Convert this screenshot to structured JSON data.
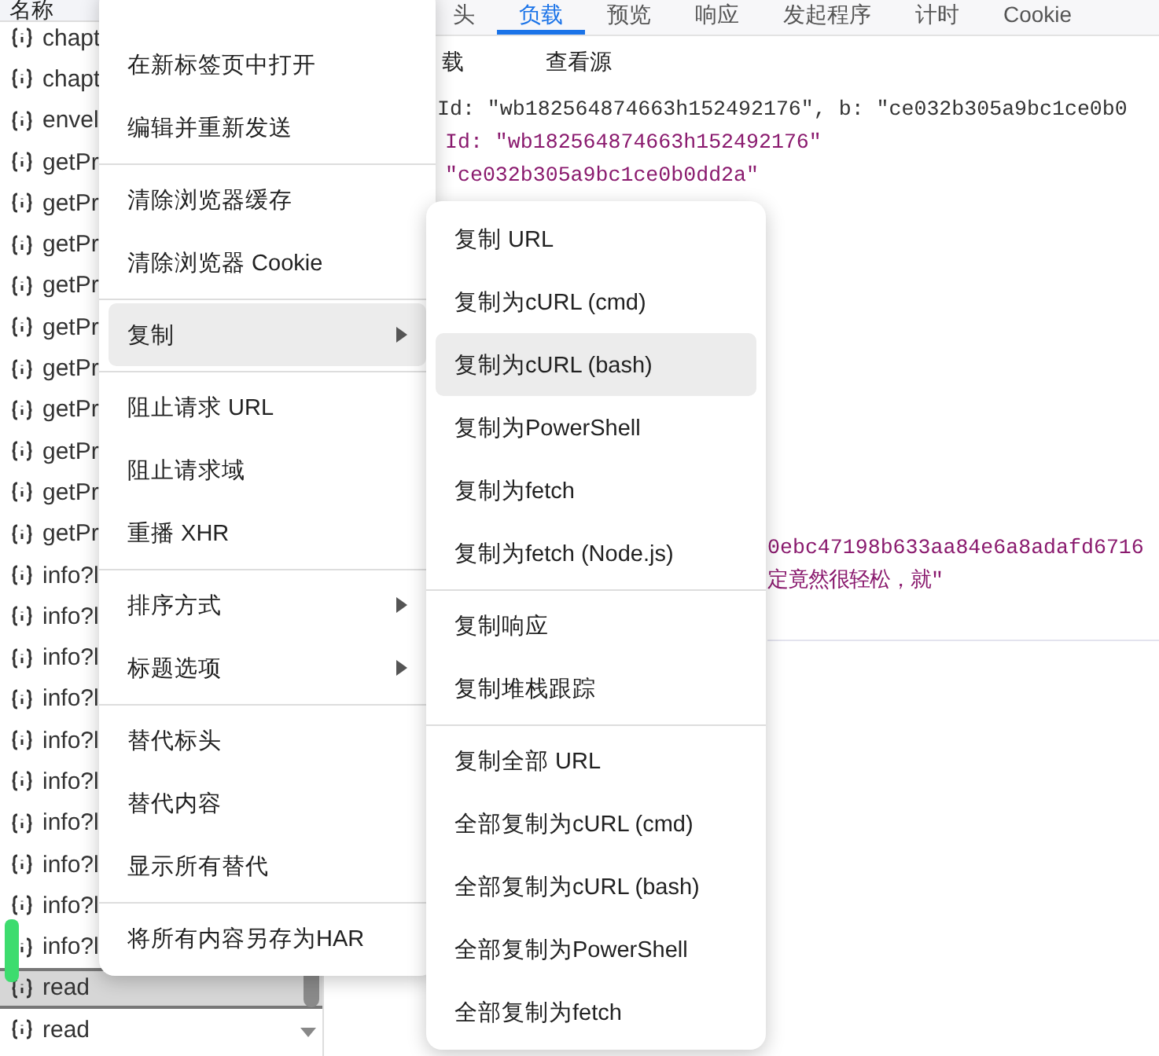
{
  "request_list": {
    "header": "名称",
    "rows": [
      {
        "name": "chapt",
        "selected": false
      },
      {
        "name": "chapt",
        "selected": false
      },
      {
        "name": "envel",
        "selected": false
      },
      {
        "name": "getPr",
        "selected": false
      },
      {
        "name": "getPr",
        "selected": false
      },
      {
        "name": "getPr",
        "selected": false
      },
      {
        "name": "getPr",
        "selected": false
      },
      {
        "name": "getPr",
        "selected": false
      },
      {
        "name": "getPr",
        "selected": false
      },
      {
        "name": "getPr",
        "selected": false
      },
      {
        "name": "getPr",
        "selected": false
      },
      {
        "name": "getPr",
        "selected": false
      },
      {
        "name": "getPr",
        "selected": false
      },
      {
        "name": "info?l",
        "selected": false
      },
      {
        "name": "info?l",
        "selected": false
      },
      {
        "name": "info?l",
        "selected": false
      },
      {
        "name": "info?l",
        "selected": false
      },
      {
        "name": "info?l",
        "selected": false
      },
      {
        "name": "info?l",
        "selected": false
      },
      {
        "name": "info?l",
        "selected": false
      },
      {
        "name": "info?l",
        "selected": false
      },
      {
        "name": "info?l",
        "selected": false
      },
      {
        "name": "info?l",
        "selected": false
      },
      {
        "name": "read",
        "selected": true
      },
      {
        "name": "read",
        "selected": false
      }
    ]
  },
  "detail": {
    "tabs": [
      {
        "label": "头",
        "selected": false
      },
      {
        "label": "负载",
        "selected": true
      },
      {
        "label": "预览",
        "selected": false
      },
      {
        "label": "响应",
        "selected": false
      },
      {
        "label": "发起程序",
        "selected": false
      },
      {
        "label": "计时",
        "selected": false
      },
      {
        "label": "Cookie",
        "selected": false
      }
    ],
    "subtabs": [
      {
        "label": "载"
      },
      {
        "label": "查看源"
      }
    ],
    "blocks": [
      {
        "lines": [
          {
            "text": "Id: \"wb182564874663h152492176\", b: \"ce032b305a9bc1ce0b0",
            "kind": "summary"
          },
          {
            "text": "Id: \"wb182564874663h152492176\"",
            "kind": "value"
          },
          {
            "text": "\"ce032b305a9bc1ce0b0dd2a\"",
            "kind": "value"
          }
        ]
      },
      {
        "lines": [
          {
            "text": "0ebc47198b633aa84e6a8adafd6716",
            "kind": "value"
          },
          {
            "text": "定竟然很轻松，就\"",
            "kind": "value"
          }
        ]
      }
    ]
  },
  "context_menu": {
    "items": [
      {
        "kind": "item",
        "label": "在新标签页中打开",
        "highlighted": false,
        "submenu": false
      },
      {
        "kind": "item",
        "label": "编辑并重新发送",
        "highlighted": false,
        "submenu": false
      },
      {
        "kind": "separator"
      },
      {
        "kind": "item",
        "label": "清除浏览器缓存",
        "highlighted": false,
        "submenu": false
      },
      {
        "kind": "item",
        "label": "清除浏览器 Cookie",
        "highlighted": false,
        "submenu": false
      },
      {
        "kind": "separator"
      },
      {
        "kind": "item",
        "label": "复制",
        "highlighted": true,
        "submenu": true
      },
      {
        "kind": "separator"
      },
      {
        "kind": "item",
        "label": "阻止请求 URL",
        "highlighted": false,
        "submenu": false
      },
      {
        "kind": "item",
        "label": "阻止请求域",
        "highlighted": false,
        "submenu": false
      },
      {
        "kind": "item",
        "label": "重播 XHR",
        "highlighted": false,
        "submenu": false
      },
      {
        "kind": "separator"
      },
      {
        "kind": "item",
        "label": "排序方式",
        "highlighted": false,
        "submenu": true
      },
      {
        "kind": "item",
        "label": "标题选项",
        "highlighted": false,
        "submenu": true
      },
      {
        "kind": "separator"
      },
      {
        "kind": "item",
        "label": "替代标头",
        "highlighted": false,
        "submenu": false
      },
      {
        "kind": "item",
        "label": "替代内容",
        "highlighted": false,
        "submenu": false
      },
      {
        "kind": "item",
        "label": "显示所有替代",
        "highlighted": false,
        "submenu": false
      },
      {
        "kind": "separator"
      },
      {
        "kind": "item",
        "label": "将所有内容另存为HAR",
        "highlighted": false,
        "submenu": false
      }
    ]
  },
  "copy_submenu": {
    "items": [
      {
        "kind": "item",
        "label": "复制 URL",
        "highlighted": false
      },
      {
        "kind": "item",
        "label": "复制为cURL (cmd)",
        "highlighted": false
      },
      {
        "kind": "item",
        "label": "复制为cURL (bash)",
        "highlighted": true
      },
      {
        "kind": "item",
        "label": "复制为PowerShell",
        "highlighted": false
      },
      {
        "kind": "item",
        "label": "复制为fetch",
        "highlighted": false
      },
      {
        "kind": "item",
        "label": "复制为fetch (Node.js)",
        "highlighted": false
      },
      {
        "kind": "separator"
      },
      {
        "kind": "item",
        "label": "复制响应",
        "highlighted": false
      },
      {
        "kind": "item",
        "label": "复制堆栈跟踪",
        "highlighted": false
      },
      {
        "kind": "separator"
      },
      {
        "kind": "item",
        "label": "复制全部 URL",
        "highlighted": false
      },
      {
        "kind": "item",
        "label": "全部复制为cURL (cmd)",
        "highlighted": false
      },
      {
        "kind": "item",
        "label": "全部复制为cURL (bash)",
        "highlighted": false
      },
      {
        "kind": "item",
        "label": "全部复制为PowerShell",
        "highlighted": false
      },
      {
        "kind": "item",
        "label": "全部复制为fetch",
        "highlighted": false
      }
    ]
  }
}
